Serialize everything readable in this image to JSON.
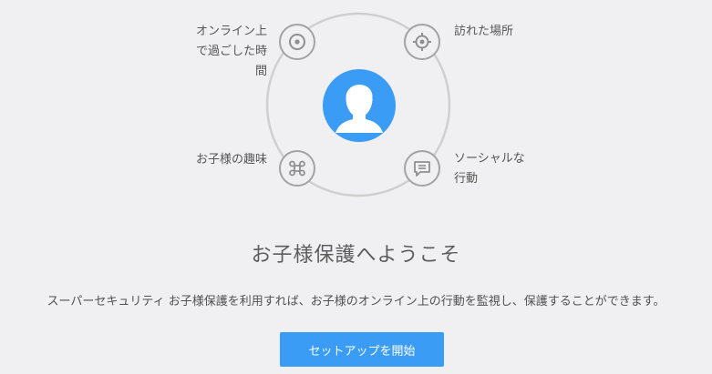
{
  "diagram": {
    "features": [
      {
        "icon": "target-circle-icon",
        "label_lines": [
          "オンライン上",
          "で過ごした時",
          "間"
        ]
      },
      {
        "icon": "location-crosshair-icon",
        "label_lines": [
          "訪れた場所"
        ]
      },
      {
        "icon": "command-icon",
        "label_lines": [
          "お子様の趣味"
        ]
      },
      {
        "icon": "chat-bubble-icon",
        "label_lines": [
          "ソーシャルな",
          "行動"
        ]
      }
    ],
    "center_icon": "child-avatar-icon",
    "colors": {
      "ring": "#cfcfcf",
      "icon_border": "#a3a3a3",
      "avatar_bg": "#3b9cf5"
    }
  },
  "welcome": {
    "title": "お子様保護へようこそ",
    "description": "スーパーセキュリティ お子様保護を利用すれば、お子様のオンライン上の行動を監視し、保護することができます。"
  },
  "setup_button": {
    "label": "セットアップを開始",
    "color": "#3b9cf5"
  }
}
